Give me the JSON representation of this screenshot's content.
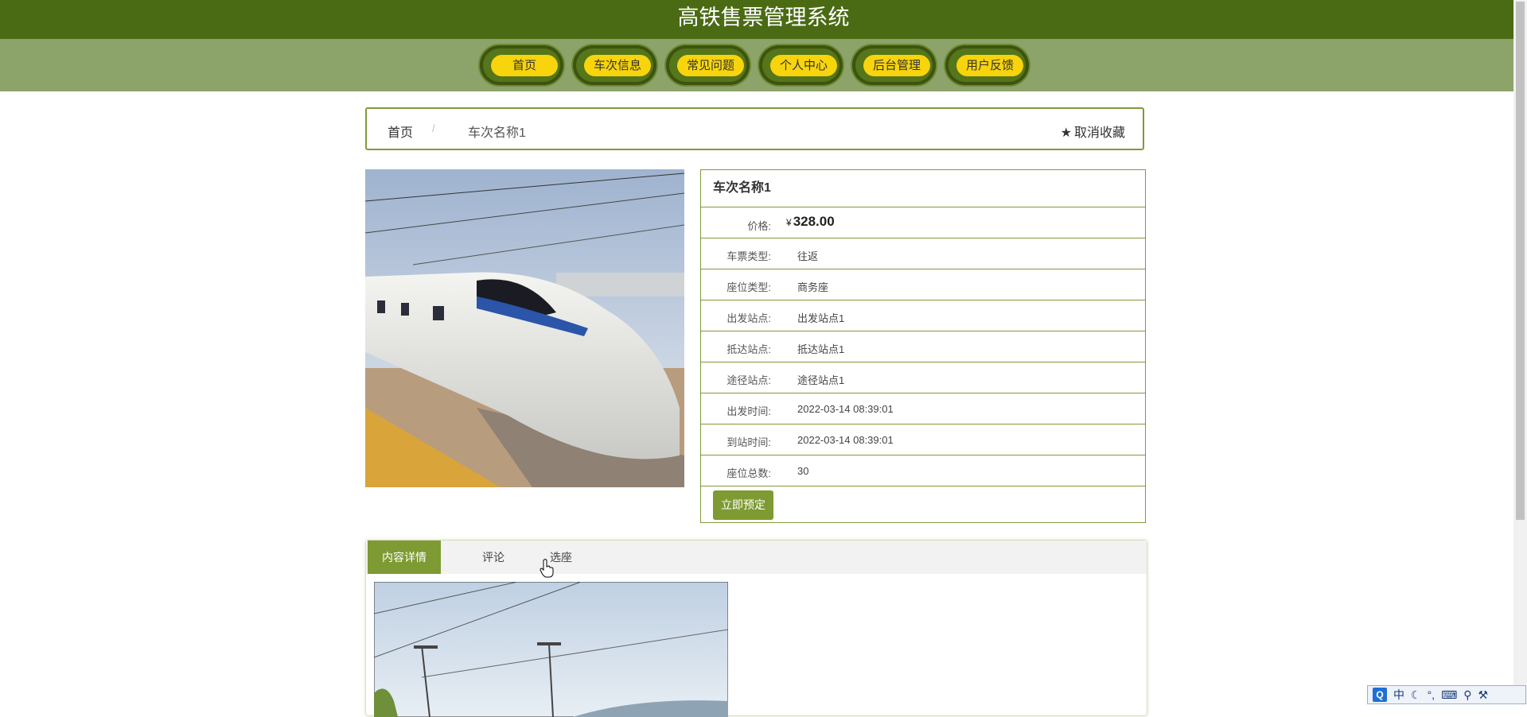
{
  "header": {
    "title": "高铁售票管理系统"
  },
  "nav": {
    "items": [
      {
        "label": "首页"
      },
      {
        "label": "车次信息"
      },
      {
        "label": "常见问题"
      },
      {
        "label": "个人中心"
      },
      {
        "label": "后台管理"
      },
      {
        "label": "用户反馈"
      }
    ]
  },
  "breadcrumb": {
    "home": "首页",
    "separator": "/",
    "current": "车次名称1",
    "favorite_label": "取消收藏"
  },
  "detail": {
    "title": "车次名称1",
    "price_label": "价格:",
    "price_currency": "¥",
    "price_value": "328.00",
    "rows": [
      {
        "label": "车票类型:",
        "value": "往返"
      },
      {
        "label": "座位类型:",
        "value": "商务座"
      },
      {
        "label": "出发站点:",
        "value": "出发站点1"
      },
      {
        "label": "抵达站点:",
        "value": "抵达站点1"
      },
      {
        "label": "途径站点:",
        "value": "途径站点1"
      },
      {
        "label": "出发时间:",
        "value": "2022-03-14 08:39:01"
      },
      {
        "label": "到站时间:",
        "value": "2022-03-14 08:39:01"
      },
      {
        "label": "座位总数:",
        "value": "30"
      }
    ],
    "book_button": "立即预定"
  },
  "tabs": {
    "items": [
      {
        "label": "内容详情"
      },
      {
        "label": "评论"
      },
      {
        "label": "选座"
      }
    ]
  },
  "ime": {
    "logo": "Q",
    "mode": "中"
  },
  "colors": {
    "topbar": "#4a6b14",
    "navbar": "#8ca46a",
    "nav_pill": "#f7d40c",
    "accent": "#7e9a32"
  }
}
